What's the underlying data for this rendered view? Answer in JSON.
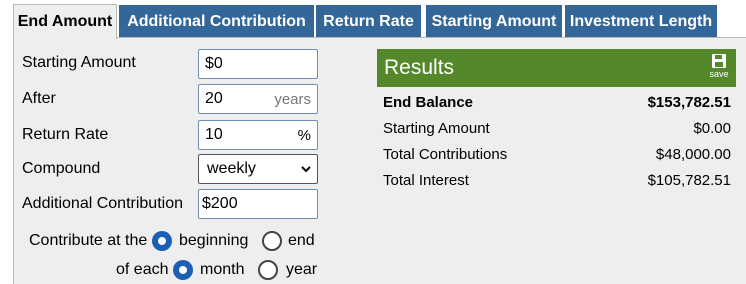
{
  "tabs": [
    {
      "label": "End Amount",
      "active": true
    },
    {
      "label": "Additional Contribution",
      "active": false
    },
    {
      "label": "Return Rate",
      "active": false
    },
    {
      "label": "Starting Amount",
      "active": false
    },
    {
      "label": "Investment Length",
      "active": false
    }
  ],
  "form": {
    "starting_amount": {
      "label": "Starting Amount",
      "value": "$0"
    },
    "after": {
      "label": "After",
      "value": "20",
      "suffix": "years"
    },
    "return_rate": {
      "label": "Return Rate",
      "value": "10",
      "suffix": "%"
    },
    "compound": {
      "label": "Compound",
      "selected": "weekly"
    },
    "additional_contribution": {
      "label": "Additional Contribution",
      "value": "$200"
    },
    "contribute_at": {
      "label": "Contribute at the",
      "options": [
        "beginning",
        "end"
      ],
      "selected": "beginning"
    },
    "of_each": {
      "label": "of each",
      "options": [
        "month",
        "year"
      ],
      "selected": "month"
    }
  },
  "results": {
    "title": "Results",
    "save_label": "save",
    "rows": [
      {
        "label": "End Balance",
        "value": "$153,782.51",
        "bold": true
      },
      {
        "label": "Starting Amount",
        "value": "$0.00",
        "bold": false
      },
      {
        "label": "Total Contributions",
        "value": "$48,000.00",
        "bold": false
      },
      {
        "label": "Total Interest",
        "value": "$105,782.51",
        "bold": false
      }
    ]
  },
  "colors": {
    "tab_bg": "#336699",
    "results_header": "#55882a",
    "radio_selected": "#1a5fb4",
    "panel_bg": "#eeeeee"
  },
  "icons": {
    "save": "save-icon",
    "dropdown": "chevron-down-icon"
  }
}
